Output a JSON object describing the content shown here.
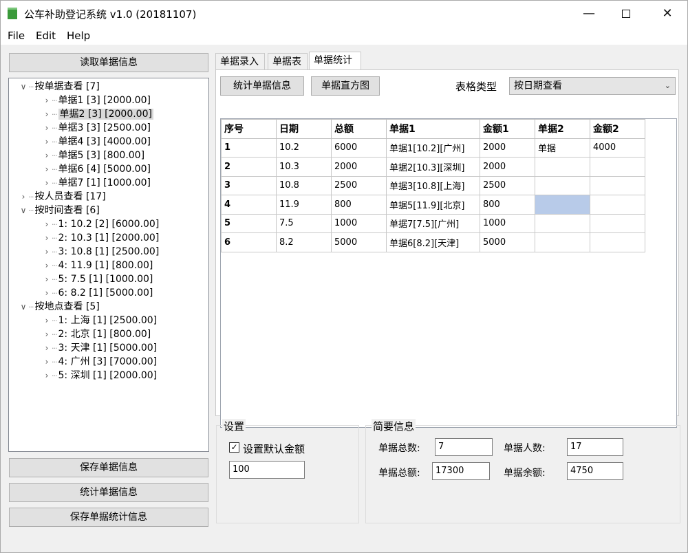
{
  "window": {
    "title": "公车补助登记系统 v1.0 (20181107)",
    "controls": {
      "minimize": "—",
      "close": "✕"
    }
  },
  "menu": [
    "File",
    "Edit",
    "Help"
  ],
  "left": {
    "read_button": "读取单据信息",
    "save_button": "保存单据信息",
    "stats_button": "统计单据信息",
    "save_stats_button": "保存单据统计信息"
  },
  "tree": {
    "nodes": [
      {
        "label": "按单据查看 [7]",
        "level": 0,
        "expanded": true
      },
      {
        "label": "单据1 [3] [2000.00]",
        "level": 1
      },
      {
        "label": "单据2 [3] [2000.00]",
        "level": 1,
        "selected": true
      },
      {
        "label": "单据3 [3] [2500.00]",
        "level": 1
      },
      {
        "label": "单据4 [3] [4000.00]",
        "level": 1
      },
      {
        "label": "单据5 [3] [800.00]",
        "level": 1
      },
      {
        "label": "单据6 [4] [5000.00]",
        "level": 1
      },
      {
        "label": "单据7 [1] [1000.00]",
        "level": 1
      },
      {
        "label": "按人员查看 [17]",
        "level": 0,
        "expanded": false
      },
      {
        "label": "按时间查看 [6]",
        "level": 0,
        "expanded": true
      },
      {
        "label": "1: 10.2 [2] [6000.00]",
        "level": 1
      },
      {
        "label": "2: 10.3 [1] [2000.00]",
        "level": 1
      },
      {
        "label": "3: 10.8 [1] [2500.00]",
        "level": 1
      },
      {
        "label": "4: 11.9 [1] [800.00]",
        "level": 1
      },
      {
        "label": "5: 7.5 [1] [1000.00]",
        "level": 1
      },
      {
        "label": "6: 8.2 [1] [5000.00]",
        "level": 1
      },
      {
        "label": "按地点查看 [5]",
        "level": 0,
        "expanded": true
      },
      {
        "label": "1: 上海 [1] [2500.00]",
        "level": 1
      },
      {
        "label": "2: 北京 [1] [800.00]",
        "level": 1
      },
      {
        "label": "3: 天津 [1] [5000.00]",
        "level": 1
      },
      {
        "label": "4: 广州 [3] [7000.00]",
        "level": 1
      },
      {
        "label": "5: 深圳 [1] [2000.00]",
        "level": 1
      }
    ]
  },
  "tabs": [
    {
      "label": "单据录入",
      "active": false
    },
    {
      "label": "单据表",
      "active": false
    },
    {
      "label": "单据统计",
      "active": true
    }
  ],
  "stats": {
    "stats_button": "统计单据信息",
    "histogram_button": "单据直方图",
    "table_type_label": "表格类型",
    "table_type_value": "按日期查看"
  },
  "grid": {
    "columns": [
      "序号",
      "日期",
      "总额",
      "单据1",
      "金额1",
      "单据2",
      "金额2"
    ],
    "rows": [
      [
        "1",
        "10.2",
        "6000",
        "单据1[10.2][广州]",
        "2000",
        "单据",
        "4000"
      ],
      [
        "2",
        "10.3",
        "2000",
        "单据2[10.3][深圳]",
        "2000",
        "",
        ""
      ],
      [
        "3",
        "10.8",
        "2500",
        "单据3[10.8][上海]",
        "2500",
        "",
        ""
      ],
      [
        "4",
        "11.9",
        "800",
        "单据5[11.9][北京]",
        "800",
        "",
        ""
      ],
      [
        "5",
        "7.5",
        "1000",
        "单据7[7.5][广州]",
        "1000",
        "",
        ""
      ],
      [
        "6",
        "8.2",
        "5000",
        "单据6[8.2][天津]",
        "5000",
        "",
        ""
      ]
    ],
    "selected_cell": {
      "row": 3,
      "col": 5
    }
  },
  "settings": {
    "title": "设置",
    "checkbox_label": "设置默认金额",
    "checked": true,
    "default_amount": "100"
  },
  "summary": {
    "title": "简要信息",
    "count_label": "单据总数:",
    "count_value": "7",
    "people_label": "单据人数:",
    "people_value": "17",
    "total_label": "单据总额:",
    "total_value": "17300",
    "balance_label": "单据余额:",
    "balance_value": "4750"
  }
}
